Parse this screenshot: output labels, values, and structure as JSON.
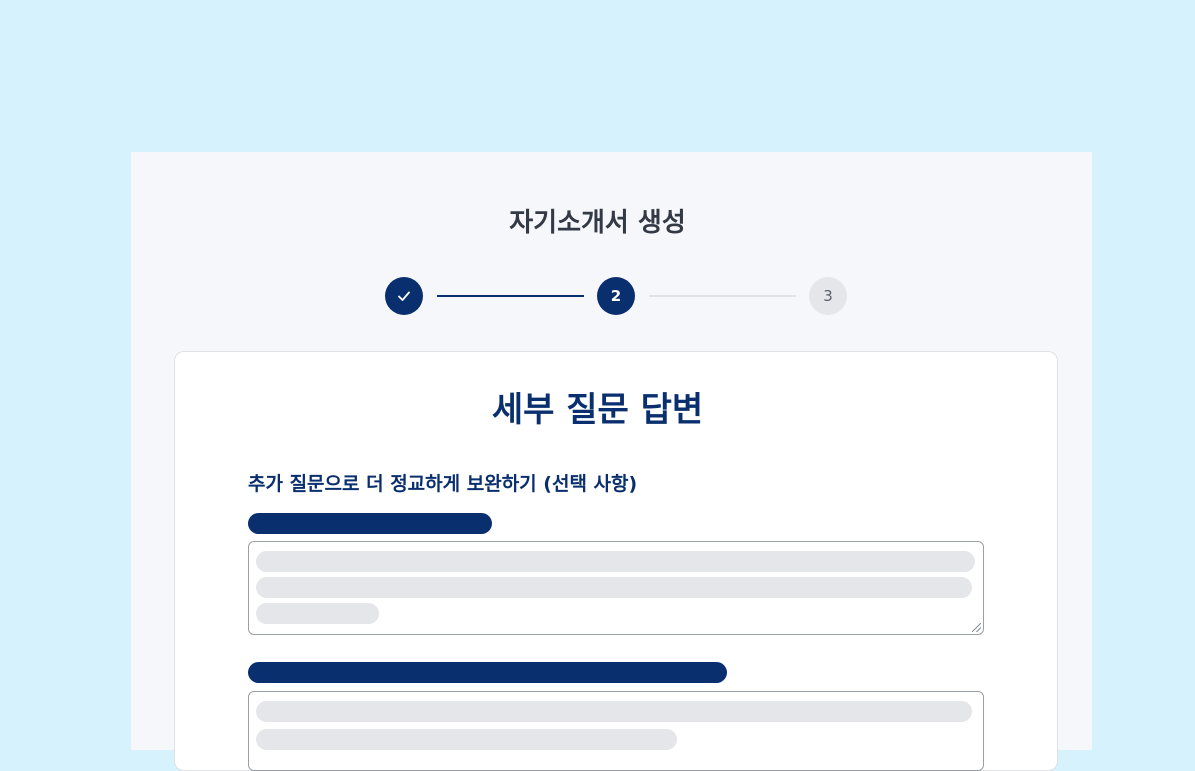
{
  "page": {
    "title": "자기소개서 생성"
  },
  "stepper": {
    "steps": [
      {
        "label": "",
        "status": "done",
        "icon": "check-icon"
      },
      {
        "label": "2",
        "status": "active"
      },
      {
        "label": "3",
        "status": "pending"
      }
    ]
  },
  "card": {
    "title": "세부 질문 답변",
    "section_label": "추가 질문으로 더 정교하게 보완하기  (선택 사항)"
  },
  "colors": {
    "background": "#d5f2fd",
    "panel": "#f6f7fa",
    "accent": "#0a2f6e",
    "skeleton": "#e5e6ea",
    "pending_step": "#e4e6ea"
  }
}
